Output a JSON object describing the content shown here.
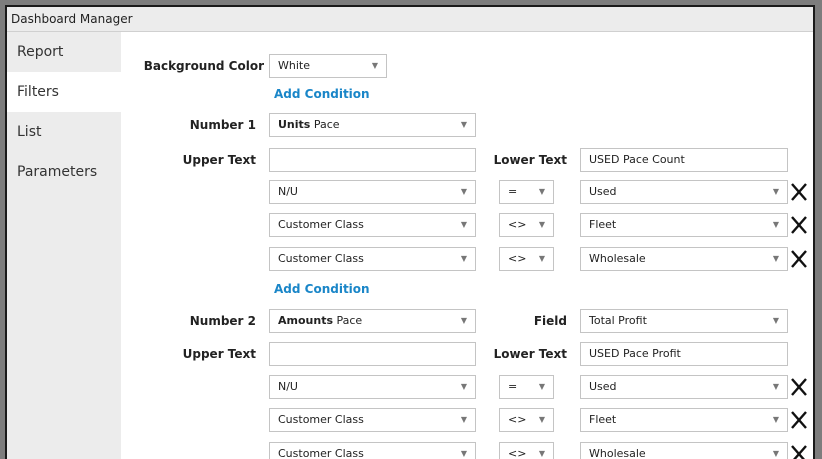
{
  "window": {
    "title": "Dashboard Manager"
  },
  "sidebar": {
    "items": [
      {
        "label": "Report"
      },
      {
        "label": "Filters"
      },
      {
        "label": "List"
      },
      {
        "label": "Parameters"
      }
    ]
  },
  "background": {
    "label": "Background Color",
    "value": "White"
  },
  "add_condition_label": "Add Condition",
  "number1": {
    "label": "Number 1",
    "type_bold": "Units",
    "type_rest": "Pace",
    "upper_label": "Upper Text",
    "upper_value": "",
    "lower_label": "Lower Text",
    "lower_value": "USED Pace Count",
    "conditions": [
      {
        "field": "N/U",
        "op": "=",
        "value": "Used"
      },
      {
        "field": "Customer Class",
        "op": "<>",
        "value": "Fleet"
      },
      {
        "field": "Customer Class",
        "op": "<>",
        "value": "Wholesale"
      }
    ]
  },
  "number2": {
    "label": "Number 2",
    "type_bold": "Amounts",
    "type_rest": "Pace",
    "field_label": "Field",
    "field_value": "Total Profit",
    "upper_label": "Upper Text",
    "upper_value": "",
    "lower_label": "Lower Text",
    "lower_value": "USED Pace Profit",
    "conditions": [
      {
        "field": "N/U",
        "op": "=",
        "value": "Used"
      },
      {
        "field": "Customer Class",
        "op": "<>",
        "value": "Fleet"
      },
      {
        "field": "Customer Class",
        "op": "<>",
        "value": "Wholesale"
      }
    ]
  },
  "icons": {
    "dropdown": "chevron-down-icon",
    "delete": "close-icon"
  }
}
